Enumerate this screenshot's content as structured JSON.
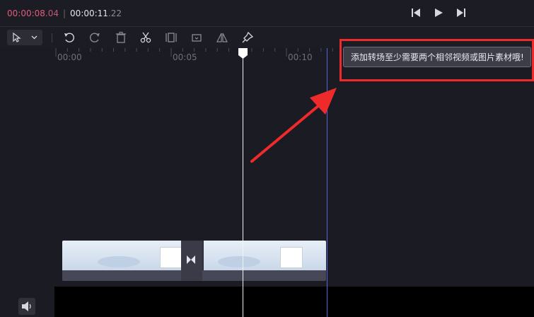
{
  "header": {
    "current_time_main": "00:00:08",
    "current_time_frac": ".04",
    "separator": "|",
    "total_time_main": "00:00:11",
    "total_time_frac": ".22"
  },
  "transport": {
    "prev_icon": "skip-back-icon",
    "play_icon": "play-icon",
    "next_icon": "skip-forward-icon"
  },
  "toolbar": {
    "tools": [
      "pointer-select-icon",
      "undo-icon",
      "redo-icon",
      "delete-icon",
      "split-scissors-icon",
      "crop-icon",
      "replace-icon",
      "mirror-icon",
      "pin-icon"
    ]
  },
  "ruler": {
    "labels": [
      "00:00",
      "00:05",
      "00:10"
    ]
  },
  "tooltip": {
    "text": "添加转场至少需要两个相邻视频或图片素材哦!"
  },
  "colors": {
    "accent_time": "#e05c7a",
    "highlight_red": "#ee2a2a",
    "marker_blue": "#5b63d6"
  }
}
